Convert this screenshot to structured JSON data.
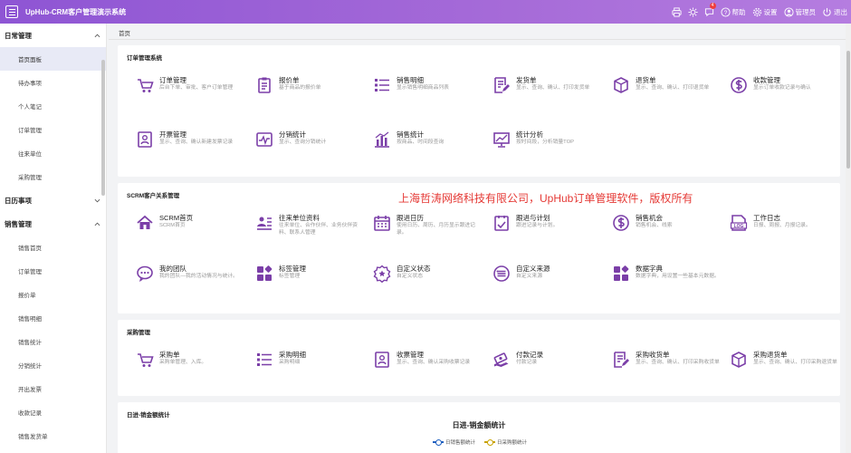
{
  "topbar": {
    "title": "UpHub-CRM客户管理演示系统",
    "notification_count": "4",
    "help_label": "帮助",
    "settings_label": "设置",
    "admin_label": "管理员",
    "logout_label": "退出"
  },
  "sidebar": {
    "groups": [
      {
        "label": "日常管理",
        "items": [
          {
            "label": "首页面板",
            "active": true
          },
          {
            "label": "待办事项"
          },
          {
            "label": "个人笔记"
          },
          {
            "label": "订单管理"
          },
          {
            "label": "往来单位"
          },
          {
            "label": "采购管理"
          }
        ]
      },
      {
        "label": "日历事项",
        "items": []
      },
      {
        "label": "销售管理",
        "items": [
          {
            "label": "销售首页"
          },
          {
            "label": "订单管理"
          },
          {
            "label": "报价单"
          },
          {
            "label": "销售明细"
          },
          {
            "label": "销售统计"
          },
          {
            "label": "分销统计"
          },
          {
            "label": "开出发票"
          },
          {
            "label": "收款记录"
          },
          {
            "label": "销售发货单"
          }
        ]
      }
    ]
  },
  "breadcrumb": "首页",
  "watermark": "上海哲涛网络科技有限公司，UpHub订单管理软件，版权所有",
  "sections": [
    {
      "title": "订单管理系统",
      "tiles": [
        {
          "icon": "cart-icon",
          "title": "订单管理",
          "desc": "后台下单、审批、客户订单管理"
        },
        {
          "icon": "clipboard-icon",
          "title": "报价单",
          "desc": "基于商品的报价单"
        },
        {
          "icon": "list-icon",
          "title": "销售明细",
          "desc": "显示销售明细商品列表"
        },
        {
          "icon": "edit-doc-icon",
          "title": "发货单",
          "desc": "显示、查询、确认、打印发货单"
        },
        {
          "icon": "box-icon",
          "title": "退货单",
          "desc": "显示、查询、确认、打印退货单"
        },
        {
          "icon": "dollar-icon",
          "title": "收款管理",
          "desc": "显示订单收款记录与确认"
        },
        {
          "icon": "invoice-icon",
          "title": "开票管理",
          "desc": "显示、查询、确认新建发票记录"
        },
        {
          "icon": "pulse-icon",
          "title": "分销统计",
          "desc": "显示、查询分销统计"
        },
        {
          "icon": "bar-chart-icon",
          "title": "销售统计",
          "desc": "按商品、时间段查询"
        },
        {
          "icon": "trend-icon",
          "title": "统计分析",
          "desc": "按时间段，分析销量TOP"
        }
      ]
    },
    {
      "title": "SCRM客户关系管理",
      "tiles": [
        {
          "icon": "home-icon",
          "title": "SCRM首页",
          "desc": "SCRM首页"
        },
        {
          "icon": "contacts-icon",
          "title": "往来单位资料",
          "desc": "往来单位、合作伙伴、业务伙伴资料、联系人管理"
        },
        {
          "icon": "calendar-icon",
          "title": "跟进日历",
          "desc": "使用日历、周历、月历显示跟进记录。"
        },
        {
          "icon": "plan-icon",
          "title": "跟进与计划",
          "desc": "跟进记录与计划。"
        },
        {
          "icon": "dollar-icon",
          "title": "销售机会",
          "desc": "销售机会、线索"
        },
        {
          "icon": "log-icon",
          "title": "工作日志",
          "desc": "日报、周报、月报记录。"
        },
        {
          "icon": "chat-icon",
          "title": "我的团队",
          "desc": "我的团队—我的活动情况与统计。"
        },
        {
          "icon": "tag-icon",
          "title": "标签管理",
          "desc": "标签管理"
        },
        {
          "icon": "badge-icon",
          "title": "自定义状态",
          "desc": "自定义状态"
        },
        {
          "icon": "source-icon",
          "title": "自定义来源",
          "desc": "自定义来源"
        },
        {
          "icon": "dict-icon",
          "title": "数据字典",
          "desc": "数据字典，用设置一些基本元数据。"
        }
      ]
    },
    {
      "title": "采购管理",
      "tiles": [
        {
          "icon": "cart-icon",
          "title": "采购单",
          "desc": "采购单管理、入库。"
        },
        {
          "icon": "list-icon",
          "title": "采购明细",
          "desc": "采购明细"
        },
        {
          "icon": "invoice-icon",
          "title": "收票管理",
          "desc": "显示、查询、确认采购收票记录"
        },
        {
          "icon": "money-icon",
          "title": "付款记录",
          "desc": "付款记录"
        },
        {
          "icon": "edit-doc-icon",
          "title": "采购收货单",
          "desc": "显示、查询、确认、打印采购收货单"
        },
        {
          "icon": "box-icon",
          "title": "采购退货单",
          "desc": "显示、查询、确认、打印采购退货单"
        }
      ]
    }
  ],
  "stats_card": {
    "title": "日进-销金额统计",
    "chart_data": {
      "type": "line",
      "title": "日进-销金额统计",
      "series": [
        {
          "name": "日销售额统计",
          "color": "#1e5fbf"
        },
        {
          "name": "日采购额统计",
          "color": "#c8a200"
        }
      ]
    }
  },
  "colors": {
    "accent": "#8e55d4",
    "icon": "#7b3fa8",
    "watermark": "#e53935"
  }
}
